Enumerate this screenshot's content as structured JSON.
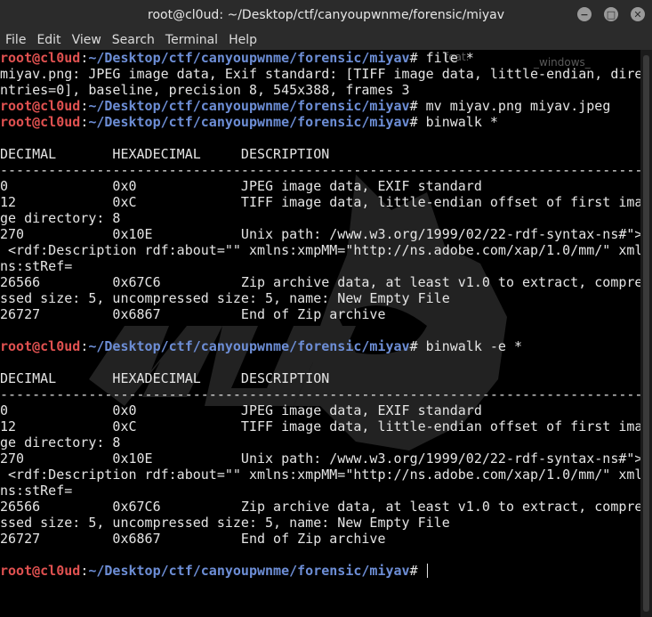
{
  "window": {
    "title": "root@cl0ud: ~/Desktop/ctf/canyoupwnme/forensic/miyav",
    "minimize_label": "−",
    "maximize_label": "□",
    "close_label": "✕"
  },
  "menu": [
    "File",
    "Edit",
    "View",
    "Search",
    "Terminal",
    "Help"
  ],
  "prompt": {
    "user": "root@cl0ud",
    "path": "~/Desktop/ctf/canyoupwnme/forensic/miyav",
    "sep": ":",
    "sym": "# "
  },
  "ghost_text": [
    "feat.",
    "_windows_"
  ],
  "lines": [
    {
      "type": "prompt",
      "cmd": "file *"
    },
    {
      "type": "text",
      "text": "miyav.png: JPEG image data, Exif standard: [TIFF image data, little-endian, dire"
    },
    {
      "type": "text",
      "text": "ntries=0], baseline, precision 8, 545x388, frames 3"
    },
    {
      "type": "prompt",
      "cmd": "mv miyav.png miyav.jpeg"
    },
    {
      "type": "prompt",
      "cmd": "binwalk *"
    },
    {
      "type": "text",
      "text": ""
    },
    {
      "type": "text",
      "text": "DECIMAL       HEXADECIMAL     DESCRIPTION"
    },
    {
      "type": "text",
      "text": "--------------------------------------------------------------------------------"
    },
    {
      "type": "text",
      "text": "0             0x0             JPEG image data, EXIF standard"
    },
    {
      "type": "text",
      "text": "12            0xC             TIFF image data, little-endian offset of first ima"
    },
    {
      "type": "text",
      "text": "ge directory: 8"
    },
    {
      "type": "text",
      "text": "270           0x10E           Unix path: /www.w3.org/1999/02/22-rdf-syntax-ns#\">"
    },
    {
      "type": "text",
      "text": " <rdf:Description rdf:about=\"\" xmlns:xmpMM=\"http://ns.adobe.com/xap/1.0/mm/\" xml"
    },
    {
      "type": "text",
      "text": "ns:stRef="
    },
    {
      "type": "text",
      "text": "26566         0x67C6          Zip archive data, at least v1.0 to extract, compre"
    },
    {
      "type": "text",
      "text": "ssed size: 5, uncompressed size: 5, name: New Empty File"
    },
    {
      "type": "text",
      "text": "26727         0x6867          End of Zip archive"
    },
    {
      "type": "text",
      "text": ""
    },
    {
      "type": "prompt",
      "cmd": "binwalk -e *"
    },
    {
      "type": "text",
      "text": ""
    },
    {
      "type": "text",
      "text": "DECIMAL       HEXADECIMAL     DESCRIPTION"
    },
    {
      "type": "text",
      "text": "--------------------------------------------------------------------------------"
    },
    {
      "type": "text",
      "text": "0             0x0             JPEG image data, EXIF standard"
    },
    {
      "type": "text",
      "text": "12            0xC             TIFF image data, little-endian offset of first ima"
    },
    {
      "type": "text",
      "text": "ge directory: 8"
    },
    {
      "type": "text",
      "text": "270           0x10E           Unix path: /www.w3.org/1999/02/22-rdf-syntax-ns#\">"
    },
    {
      "type": "text",
      "text": " <rdf:Description rdf:about=\"\" xmlns:xmpMM=\"http://ns.adobe.com/xap/1.0/mm/\" xml"
    },
    {
      "type": "text",
      "text": "ns:stRef="
    },
    {
      "type": "text",
      "text": "26566         0x67C6          Zip archive data, at least v1.0 to extract, compre"
    },
    {
      "type": "text",
      "text": "ssed size: 5, uncompressed size: 5, name: New Empty File"
    },
    {
      "type": "text",
      "text": "26727         0x6867          End of Zip archive"
    },
    {
      "type": "text",
      "text": ""
    },
    {
      "type": "prompt",
      "cmd": "",
      "cursor": true
    }
  ],
  "colors": {
    "user": "#e05150",
    "path": "#6d8ed6",
    "text": "#e4e4e4",
    "background": "#000000",
    "chrome": "#2b2b2b"
  }
}
